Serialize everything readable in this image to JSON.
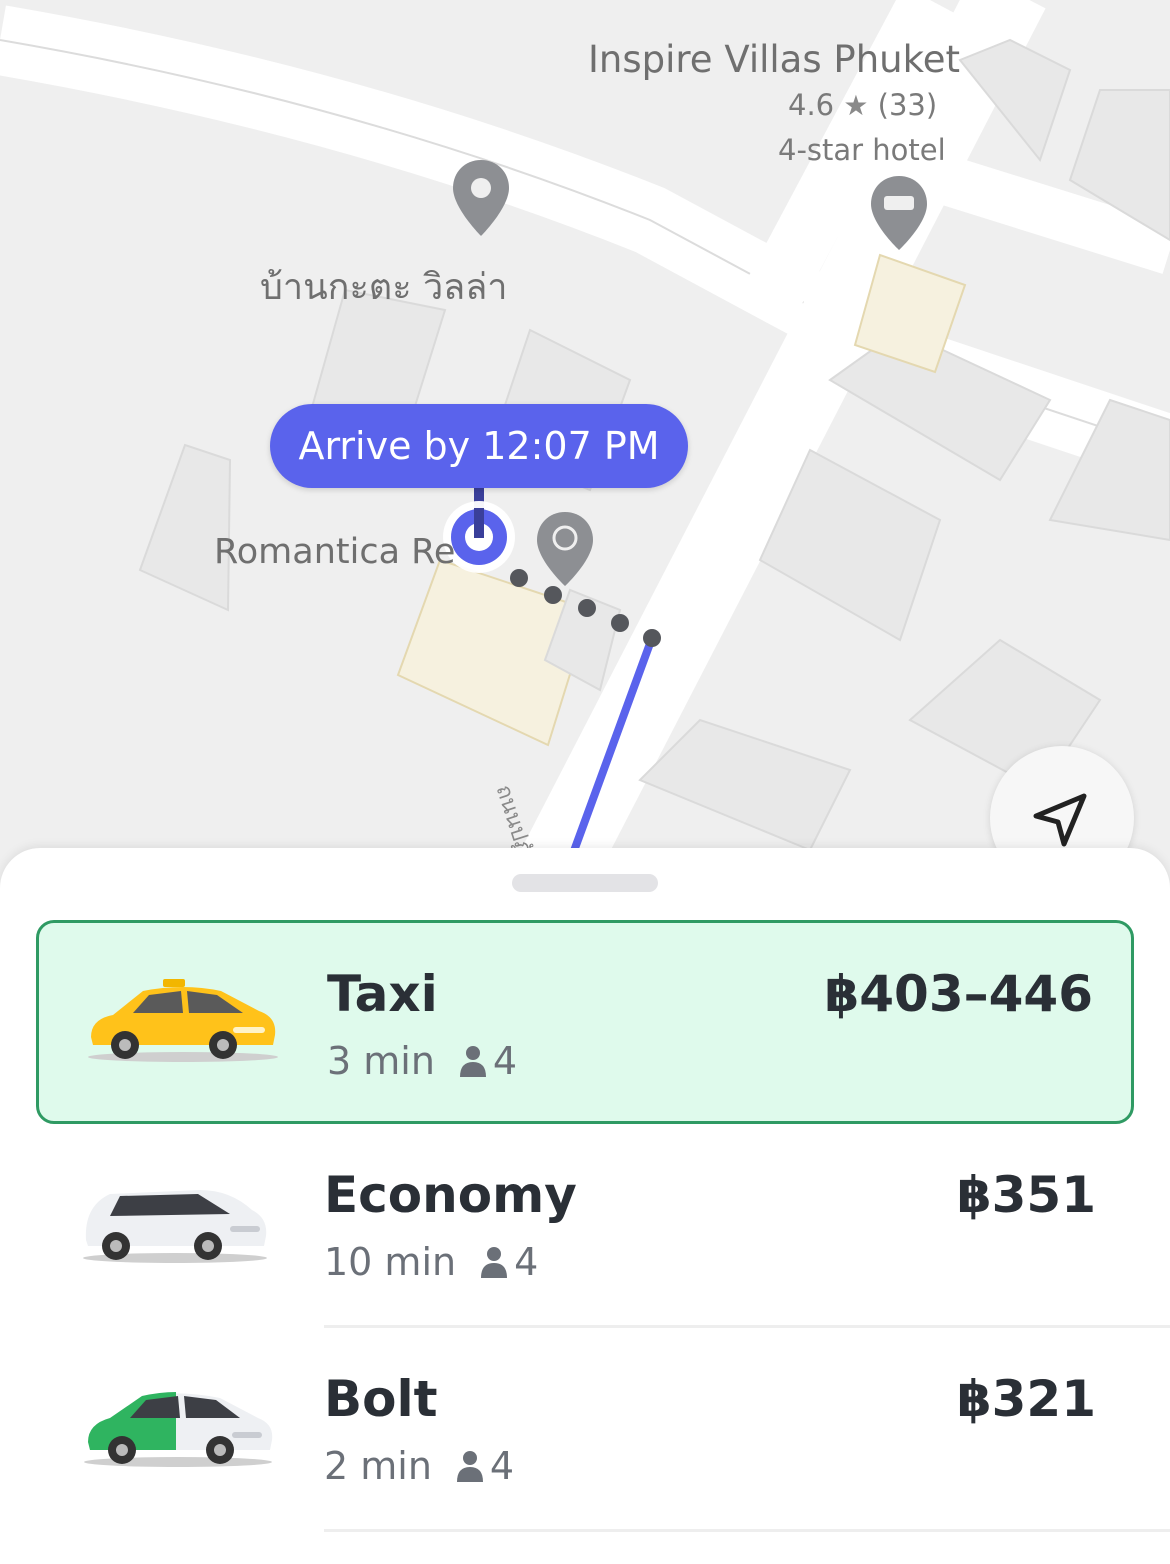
{
  "map": {
    "poi": {
      "name": "Inspire Villas Phuket",
      "rating": "4.6",
      "reviews": "(33)",
      "category": "4-star hotel"
    },
    "place_thai": "บ้านกะตะ วิลล่า",
    "resort_label": "Romantica Re",
    "street_label": "ถนนปฏัก",
    "arrive_label": "Arrive by 12:07 PM"
  },
  "rides": [
    {
      "name": "Taxi",
      "price": "฿403–446",
      "eta": "3 min",
      "seats": "4",
      "selected": true,
      "icon": "yellow-taxi-car"
    },
    {
      "name": "Economy",
      "price": "฿351",
      "eta": "10 min",
      "seats": "4",
      "selected": false,
      "icon": "white-economy-car"
    },
    {
      "name": "Bolt",
      "price": "฿321",
      "eta": "2 min",
      "seats": "4",
      "selected": false,
      "icon": "green-bolt-car"
    }
  ],
  "colors": {
    "accent": "#5a63ec",
    "selected_bg": "#dffaec",
    "selected_border": "#2f9a63",
    "text": "#2a2f36"
  }
}
